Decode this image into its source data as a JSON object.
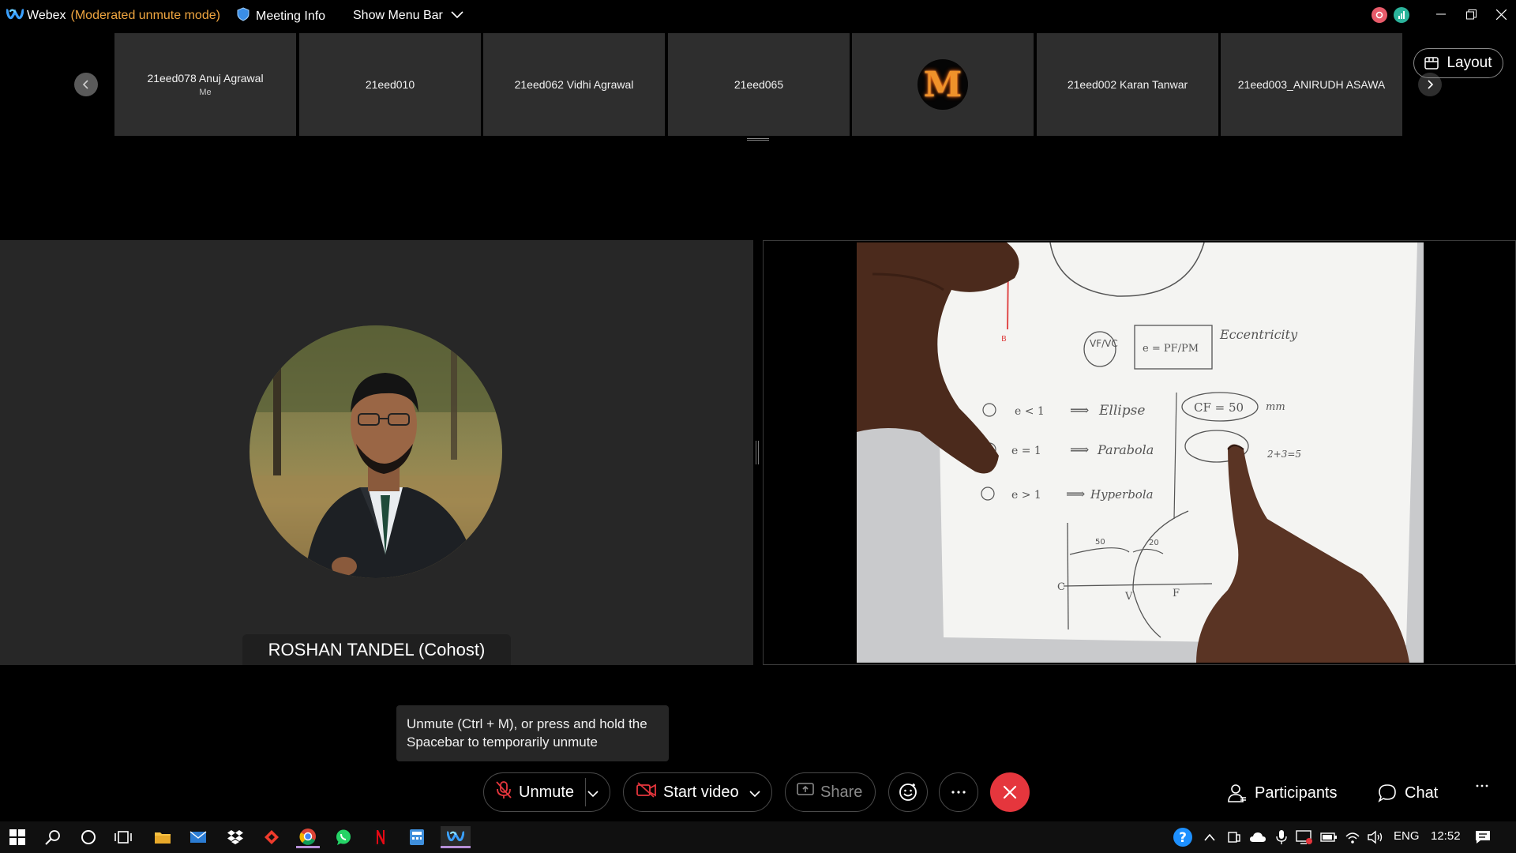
{
  "titlebar": {
    "app_name": "Webex",
    "mode": "(Moderated unmute mode)",
    "meeting_info": "Meeting Info",
    "show_menu_bar": "Show Menu Bar",
    "status_dot_colors": [
      "#e85b6a",
      "#2bb39b"
    ]
  },
  "thumbnails": [
    {
      "name": "21eed078 Anuj Agrawal",
      "sub": "Me"
    },
    {
      "name": "21eed010",
      "sub": ""
    },
    {
      "name": "21eed062 Vidhi Agrawal",
      "sub": ""
    },
    {
      "name": "21eed065",
      "sub": ""
    },
    {
      "name": "",
      "sub": "",
      "avatar_letter": "M"
    },
    {
      "name": "21eed002 Karan Tanwar",
      "sub": ""
    },
    {
      "name": "21eed003_ANIRUDH ASAWA",
      "sub": ""
    }
  ],
  "layout_label": "Layout",
  "active_speaker": {
    "name": "ROSHAN TANDEL (Cohost)"
  },
  "shared_video": {
    "notes": [
      "Eccentricity",
      "Ellipse",
      "Parabola",
      "Hyperbola",
      "CF = 50",
      "mm",
      "e < 1",
      "e = 1",
      "e > 1",
      "e = PF/PM",
      "VF/VC",
      "2+3=5",
      "50",
      "20",
      "C",
      "V",
      "F"
    ]
  },
  "tooltip": {
    "text": "Unmute (Ctrl + M), or press and hold the Spacebar to temporarily unmute"
  },
  "controls": {
    "unmute": "Unmute",
    "start_video": "Start video",
    "share": "Share",
    "participants": "Participants",
    "chat": "Chat"
  },
  "colors": {
    "accent_mode": "#f0a640",
    "end_call": "#e5363d",
    "panel": "#272727"
  },
  "taskbar": {
    "language": "ENG",
    "time": "12:52",
    "apps": [
      "start-icon",
      "search-icon",
      "cortana-icon",
      "task-view-icon",
      "file-explorer-icon",
      "mail-icon",
      "dropbox-icon",
      "anydesk-icon",
      "chrome-icon",
      "whatsapp-icon",
      "netflix-icon",
      "calculator-icon",
      "webex-icon"
    ]
  }
}
